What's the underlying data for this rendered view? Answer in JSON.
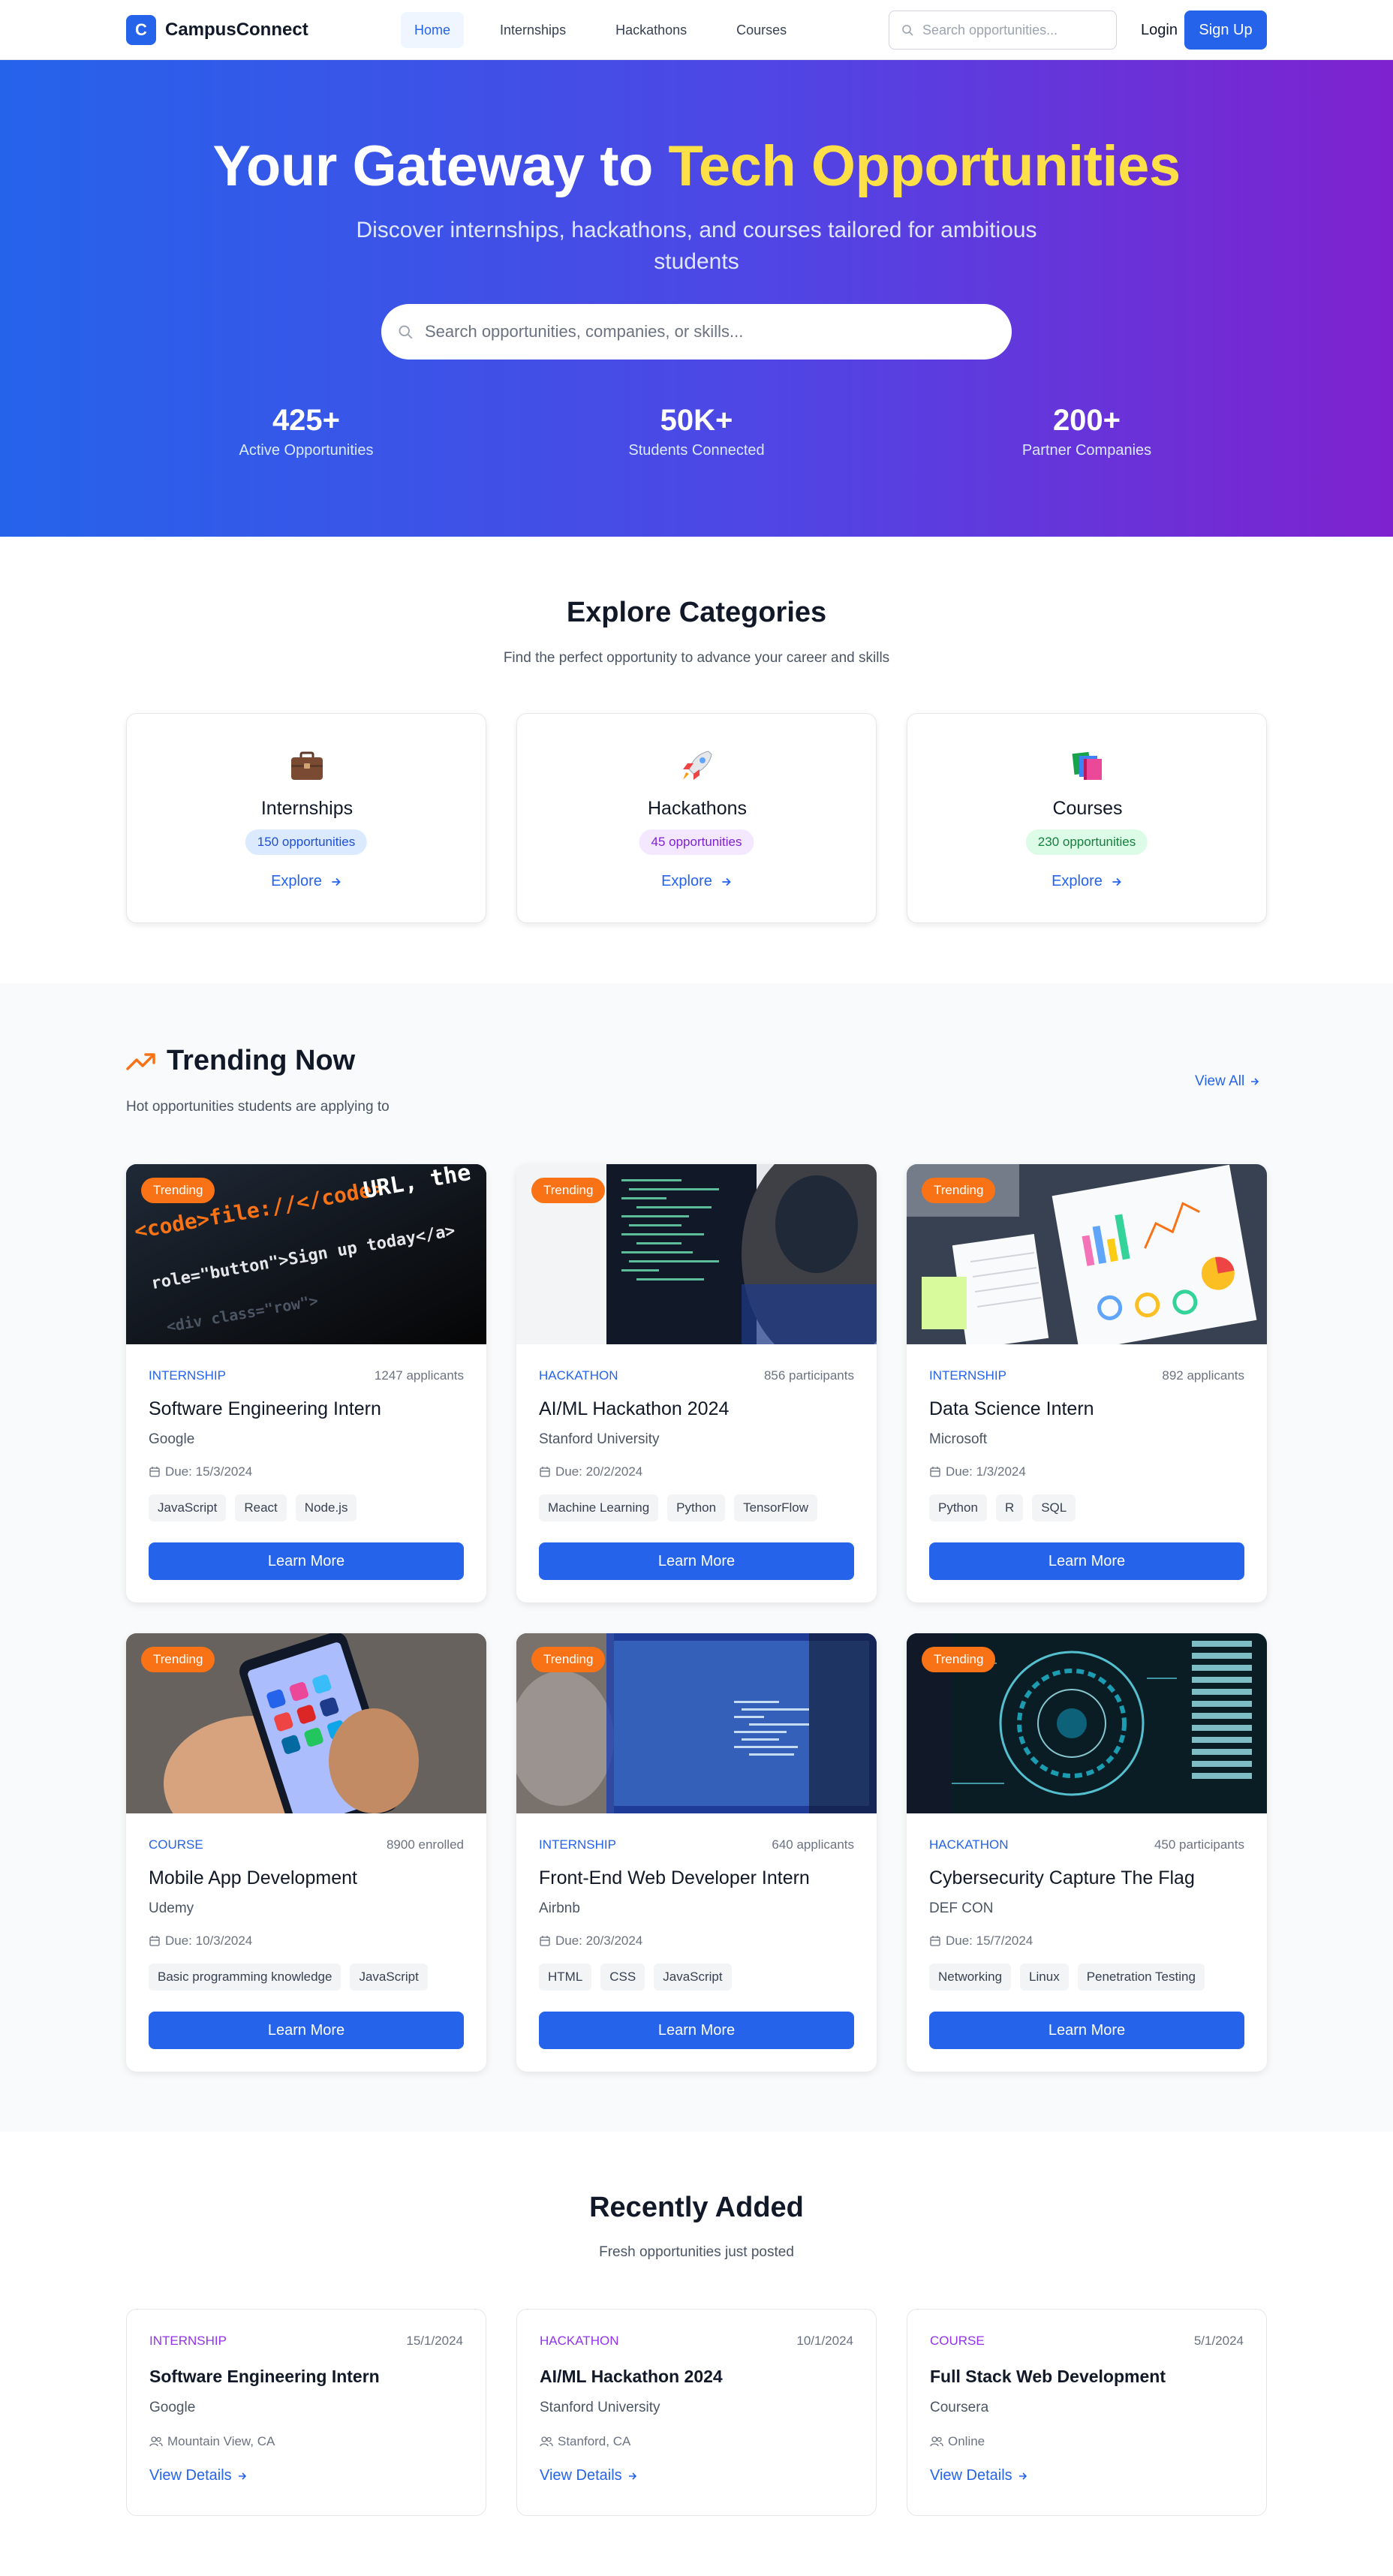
{
  "nav": {
    "logo_letter": "C",
    "brand": "CampusConnect",
    "links": [
      "Home",
      "Internships",
      "Hackathons",
      "Courses"
    ],
    "search_placeholder": "Search opportunities...",
    "login": "Login",
    "signup": "Sign Up"
  },
  "hero": {
    "title_start": "Your Gateway to ",
    "title_highlight": "Tech Opportunities",
    "subtitle": "Discover internships, hackathons, and courses tailored for ambitious students",
    "search_placeholder": "Search opportunities, companies, or skills...",
    "stats": [
      {
        "value": "425+",
        "label": "Active Opportunities"
      },
      {
        "value": "50K+",
        "label": "Students Connected"
      },
      {
        "value": "200+",
        "label": "Partner Companies"
      }
    ]
  },
  "categories": {
    "title": "Explore Categories",
    "subtitle": "Find the perfect opportunity to advance your career and skills",
    "items": [
      {
        "name": "Internships",
        "count": "150 opportunities",
        "cta": "Explore",
        "icon": "briefcase-icon"
      },
      {
        "name": "Hackathons",
        "count": "45 opportunities",
        "cta": "Explore",
        "icon": "rocket-icon"
      },
      {
        "name": "Courses",
        "count": "230 opportunities",
        "cta": "Explore",
        "icon": "books-icon"
      }
    ]
  },
  "trending": {
    "title": "Trending Now",
    "subtitle": "Hot opportunities students are applying to",
    "view_all": "View All",
    "cards": [
      {
        "badge": "Trending",
        "type": "INTERNSHIP",
        "count": "1247 applicants",
        "title": "Software Engineering Intern",
        "org": "Google",
        "due": "Due: 15/3/2024",
        "tags": [
          "JavaScript",
          "React",
          "Node.js"
        ],
        "cta": "Learn More",
        "image": "code-photo"
      },
      {
        "badge": "Trending",
        "type": "HACKATHON",
        "count": "856 participants",
        "title": "AI/ML Hackathon 2024",
        "org": "Stanford University",
        "due": "Due: 20/2/2024",
        "tags": [
          "Machine Learning",
          "Python",
          "TensorFlow"
        ],
        "cta": "Learn More",
        "image": "coder-photo"
      },
      {
        "badge": "Trending",
        "type": "INTERNSHIP",
        "count": "892 applicants",
        "title": "Data Science Intern",
        "org": "Microsoft",
        "due": "Due: 1/3/2024",
        "tags": [
          "Python",
          "R",
          "SQL"
        ],
        "cta": "Learn More",
        "image": "charts-photo"
      },
      {
        "badge": "Trending",
        "type": "COURSE",
        "count": "8900 enrolled",
        "title": "Mobile App Development",
        "org": "Udemy",
        "due": "Due: 10/3/2024",
        "tags": [
          "Basic programming knowledge",
          "JavaScript"
        ],
        "cta": "Learn More",
        "image": "phone-photo"
      },
      {
        "badge": "Trending",
        "type": "INTERNSHIP",
        "count": "640 applicants",
        "title": "Front-End Web Developer Intern",
        "org": "Airbnb",
        "due": "Due: 20/3/2024",
        "tags": [
          "HTML",
          "CSS",
          "JavaScript"
        ],
        "cta": "Learn More",
        "image": "monitor-photo"
      },
      {
        "badge": "Trending",
        "type": "HACKATHON",
        "count": "450 participants",
        "title": "Cybersecurity Capture The Flag",
        "org": "DEF CON",
        "due": "Due: 15/7/2024",
        "tags": [
          "Networking",
          "Linux",
          "Penetration Testing"
        ],
        "cta": "Learn More",
        "image": "cyber-photo"
      }
    ]
  },
  "recent": {
    "title": "Recently Added",
    "subtitle": "Fresh opportunities just posted",
    "cards": [
      {
        "type": "INTERNSHIP",
        "date": "15/1/2024",
        "title": "Software Engineering Intern",
        "org": "Google",
        "location": "Mountain View, CA",
        "cta": "View Details"
      },
      {
        "type": "HACKATHON",
        "date": "10/1/2024",
        "title": "AI/ML Hackathon 2024",
        "org": "Stanford University",
        "location": "Stanford, CA",
        "cta": "View Details"
      },
      {
        "type": "COURSE",
        "date": "5/1/2024",
        "title": "Full Stack Web Development",
        "org": "Coursera",
        "location": "Online",
        "cta": "View Details"
      }
    ]
  },
  "colors": {
    "primary": "#2563eb",
    "accent": "#fde047",
    "trending_badge": "#f97316",
    "recent_type": "#9333ea"
  }
}
